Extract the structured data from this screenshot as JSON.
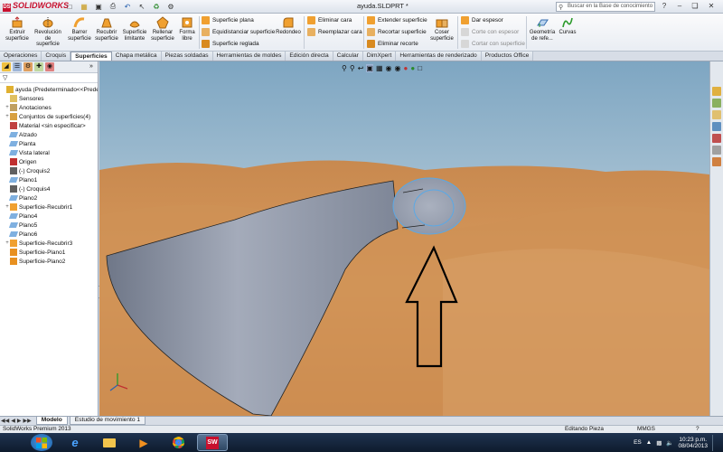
{
  "app": {
    "brand": "SOLIDWORKS",
    "doc_title": "ayuda.SLDPRT *",
    "search_placeholder": "Buscar en la Base de conocimiento"
  },
  "ribbon": {
    "big_buttons": [
      {
        "label": "Extruir superficie",
        "icon": "extrude-surface-icon"
      },
      {
        "label": "Revolución de superficie",
        "icon": "revolve-surface-icon"
      },
      {
        "label": "Barrer superficie",
        "icon": "sweep-surface-icon"
      },
      {
        "label": "Recubrir superficie",
        "icon": "loft-surface-icon"
      },
      {
        "label": "Superficie limitante",
        "icon": "boundary-surface-icon"
      },
      {
        "label": "Rellenar superficie",
        "icon": "fill-surface-icon"
      },
      {
        "label": "Forma libre",
        "icon": "freeform-icon"
      }
    ],
    "col1": [
      "Superficie plana",
      "Equidistanciar superficie",
      "Superficie reglada"
    ],
    "redondeo": "Redondeo",
    "col2": [
      "Eliminar cara",
      "Reemplazar cara"
    ],
    "col3": [
      "Extender superficie",
      "Recortar superficie",
      "Eliminar recorte"
    ],
    "coser": "Coser superficie",
    "col4": [
      "Dar espesor",
      "Corte con espesor",
      "Cortar con superficie"
    ],
    "ref_geom": "Geometría de refe...",
    "curvas": "Curvas"
  },
  "tabs": [
    "Operaciones",
    "Croquis",
    "Superficies",
    "Chapa metálica",
    "Piezas soldadas",
    "Herramientas de moldes",
    "Edición directa",
    "Calcular",
    "DimXpert",
    "Herramientas de renderizado",
    "Productos Office"
  ],
  "active_tab": "Superficies",
  "tree": [
    {
      "label": "ayuda  (Predeterminado<<Prede",
      "indent": 0,
      "exp": "",
      "icon": "part-icon"
    },
    {
      "label": "Sensores",
      "indent": 1,
      "exp": "",
      "icon": "sensor-icon"
    },
    {
      "label": "Anotaciones",
      "indent": 1,
      "exp": "+",
      "icon": "annotation-icon"
    },
    {
      "label": "Conjuntos de superficies(4)",
      "indent": 1,
      "exp": "+",
      "icon": "surface-bodies-icon"
    },
    {
      "label": "Material <sin especificar>",
      "indent": 1,
      "exp": "",
      "icon": "material-icon"
    },
    {
      "label": "Alzado",
      "indent": 1,
      "exp": "",
      "icon": "plane-icon"
    },
    {
      "label": "Planta",
      "indent": 1,
      "exp": "",
      "icon": "plane-icon"
    },
    {
      "label": "Vista lateral",
      "indent": 1,
      "exp": "",
      "icon": "plane-icon"
    },
    {
      "label": "Origen",
      "indent": 1,
      "exp": "",
      "icon": "origin-icon"
    },
    {
      "label": "(-) Croquis2",
      "indent": 1,
      "exp": "",
      "icon": "sketch-icon"
    },
    {
      "label": "Plano1",
      "indent": 1,
      "exp": "",
      "icon": "plane-icon"
    },
    {
      "label": "(-) Croquis4",
      "indent": 1,
      "exp": "",
      "icon": "sketch-icon"
    },
    {
      "label": "Plano2",
      "indent": 1,
      "exp": "",
      "icon": "plane-icon"
    },
    {
      "label": "Superficie-Recubrir1",
      "indent": 1,
      "exp": "+",
      "icon": "loft-feature-icon"
    },
    {
      "label": "Plano4",
      "indent": 1,
      "exp": "",
      "icon": "plane-icon"
    },
    {
      "label": "Plano5",
      "indent": 1,
      "exp": "",
      "icon": "plane-icon"
    },
    {
      "label": "Plano6",
      "indent": 1,
      "exp": "",
      "icon": "plane-icon"
    },
    {
      "label": "Superficie-Recubrir3",
      "indent": 1,
      "exp": "+",
      "icon": "loft-feature-icon"
    },
    {
      "label": "Superficie-Plano1",
      "indent": 1,
      "exp": "",
      "icon": "planar-surface-icon"
    },
    {
      "label": "Superficie-Plano2",
      "indent": 1,
      "exp": "",
      "icon": "planar-surface-icon"
    }
  ],
  "bottom_tabs": [
    "Modelo",
    "Estudio de movimiento 1"
  ],
  "status": {
    "product": "SolidWorks Premium 2013",
    "mode": "Editando Pieza",
    "units": "MMGS",
    "help": "?"
  },
  "taskbar": {
    "lang": "ES",
    "time": "10:23 p.m.",
    "date": "08/04/2013"
  },
  "colors": {
    "brand_red": "#c8102e",
    "surface_gray": "#8f97a8",
    "selection_blue": "#5aa9e6",
    "sky": "#9fc0d4",
    "sand": "#c98a50"
  }
}
